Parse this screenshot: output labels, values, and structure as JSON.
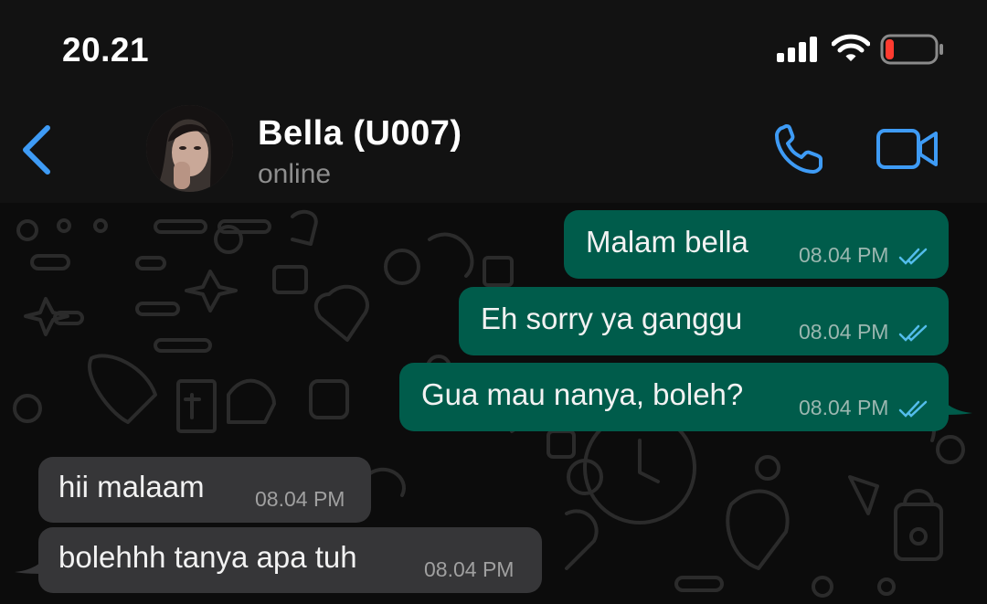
{
  "status_bar": {
    "time": "20.21",
    "signal_icon": "cellular-signal-icon",
    "wifi_icon": "wifi-icon",
    "battery_icon": "battery-low-icon",
    "battery_color": "#ff3b30"
  },
  "header": {
    "back_icon": "chevron-left-icon",
    "contact_name": "Bella (U007)",
    "contact_status": "online",
    "call_icon": "phone-icon",
    "video_icon": "video-camera-icon",
    "accent_color": "#3e9bf5"
  },
  "messages": [
    {
      "direction": "outgoing",
      "text": "Malam bella",
      "time": "08.04 PM",
      "status": "read"
    },
    {
      "direction": "outgoing",
      "text": "Eh sorry ya ganggu",
      "time": "08.04 PM",
      "status": "read"
    },
    {
      "direction": "outgoing",
      "text": "Gua mau nanya, boleh?",
      "time": "08.04 PM",
      "status": "read"
    },
    {
      "direction": "incoming",
      "text": "hii malaam",
      "time": "08.04 PM"
    },
    {
      "direction": "incoming",
      "text": "bolehhh tanya apa tuh",
      "time": "08.04 PM"
    }
  ],
  "colors": {
    "outgoing_bubble": "#005c4b",
    "incoming_bubble": "#363638",
    "read_ticks": "#53bdeb"
  }
}
